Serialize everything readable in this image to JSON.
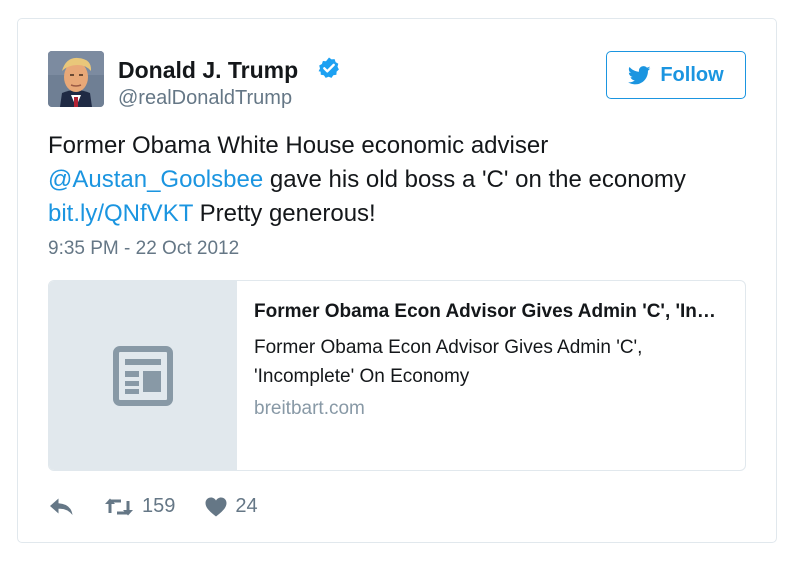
{
  "tweet": {
    "author": {
      "name": "Donald J. Trump",
      "handle": "@realDonaldTrump",
      "verified": true
    },
    "follow_label": "Follow",
    "text": {
      "line1": "Former Obama White House economic adviser",
      "mention": "@Austan_Goolsbee",
      "line2_rest": " gave his old boss a 'C' on the economy",
      "link": "bit.ly/QNfVKT",
      "line3_rest": " Pretty generous!"
    },
    "timestamp": "9:35 PM - 22 Oct 2012",
    "card": {
      "title": "Former Obama Econ Advisor Gives Admin 'C', 'Incomplete' On Economy",
      "description": "Former Obama Econ Advisor Gives Admin 'C', 'Incomplete' On Economy",
      "domain": "breitbart.com",
      "thumbnail_icon": "article-icon"
    },
    "stats": {
      "retweets": "159",
      "likes": "24"
    }
  },
  "icons": {
    "verified": "verified-badge-icon",
    "follow": "twitter-bird-icon",
    "reply": "reply-icon",
    "retweet": "retweet-icon",
    "like": "heart-icon"
  },
  "colors": {
    "accent": "#1b95e0",
    "verified": "#1da1f2",
    "text": "#14171a",
    "secondary": "#657786",
    "border": "#e1e8ed"
  }
}
